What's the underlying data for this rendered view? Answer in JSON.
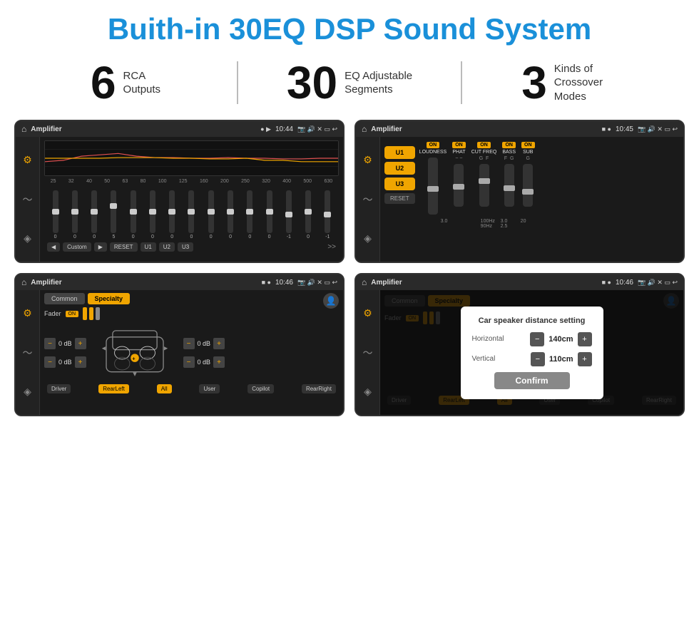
{
  "header": {
    "title": "Buith-in 30EQ DSP Sound System"
  },
  "stats": [
    {
      "number": "6",
      "label": "RCA\nOutputs"
    },
    {
      "number": "30",
      "label": "EQ Adjustable\nSegments"
    },
    {
      "number": "3",
      "label": "Kinds of\nCrossover Modes"
    }
  ],
  "screen1": {
    "app": "Amplifier",
    "time": "10:44",
    "freqs": [
      "25",
      "32",
      "40",
      "50",
      "63",
      "80",
      "100",
      "125",
      "160",
      "200",
      "250",
      "320",
      "400",
      "500",
      "630"
    ],
    "vals": [
      "0",
      "0",
      "0",
      "5",
      "0",
      "0",
      "0",
      "0",
      "0",
      "0",
      "0",
      "0",
      "-1",
      "0",
      "-1"
    ],
    "preset": "Custom",
    "buttons": [
      "RESET",
      "U1",
      "U2",
      "U3"
    ]
  },
  "screen2": {
    "app": "Amplifier",
    "time": "10:45",
    "presets": [
      "U1",
      "U2",
      "U3"
    ],
    "controls": [
      {
        "label": "LOUDNESS",
        "on": true
      },
      {
        "label": "PHAT",
        "on": true
      },
      {
        "label": "CUT FREQ",
        "on": true
      },
      {
        "label": "BASS",
        "on": true
      },
      {
        "label": "SUB",
        "on": true
      }
    ],
    "resetBtn": "RESET"
  },
  "screen3": {
    "app": "Amplifier",
    "time": "10:46",
    "tabs": [
      "Common",
      "Specialty"
    ],
    "fader": "Fader",
    "faderOn": "ON",
    "dBvals": [
      "0 dB",
      "0 dB",
      "0 dB",
      "0 dB"
    ],
    "buttons": [
      "Driver",
      "RearLeft",
      "All",
      "User",
      "Copilot",
      "RearRight"
    ]
  },
  "screen4": {
    "app": "Amplifier",
    "time": "10:46",
    "tabs": [
      "Common",
      "Specialty"
    ],
    "dialog": {
      "title": "Car speaker distance setting",
      "horizontal": {
        "label": "Horizontal",
        "value": "140cm"
      },
      "vertical": {
        "label": "Vertical",
        "value": "110cm"
      },
      "confirmBtn": "Confirm"
    },
    "buttons": [
      "Driver",
      "RearLeft",
      "All",
      "User",
      "Copilot",
      "RearRight"
    ]
  }
}
